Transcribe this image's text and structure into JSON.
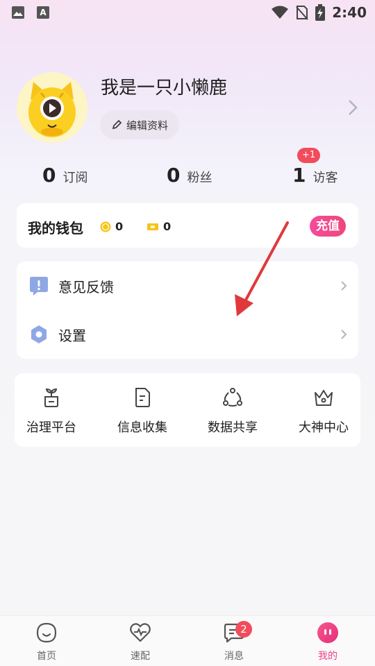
{
  "status_bar": {
    "time": "2:40",
    "icons": [
      "image-icon",
      "font-a-icon",
      "wifi-icon",
      "no-sim-icon",
      "battery-charging-icon"
    ]
  },
  "profile": {
    "username": "我是一只小懒鹿",
    "edit_label": "编辑资料"
  },
  "stats": [
    {
      "value": "0",
      "label": "订阅"
    },
    {
      "value": "0",
      "label": "粉丝"
    },
    {
      "value": "1",
      "label": "访客",
      "badge": "+1"
    }
  ],
  "wallet": {
    "title": "我的钱包",
    "coins": "0",
    "tickets": "0",
    "recharge_label": "充值"
  },
  "menu": [
    {
      "label": "意见反馈",
      "icon": "feedback-icon"
    },
    {
      "label": "设置",
      "icon": "settings-icon"
    }
  ],
  "tools": [
    {
      "label": "治理平台",
      "icon": "plant-icon"
    },
    {
      "label": "信息收集",
      "icon": "document-icon"
    },
    {
      "label": "数据共享",
      "icon": "share-nodes-icon"
    },
    {
      "label": "大神中心",
      "icon": "crown-icon"
    }
  ],
  "tabbar": [
    {
      "label": "首页",
      "icon": "home-face-icon"
    },
    {
      "label": "速配",
      "icon": "heart-pulse-icon"
    },
    {
      "label": "消息",
      "icon": "chat-icon",
      "badge": "2"
    },
    {
      "label": "我的",
      "icon": "me-face-icon",
      "active": true
    }
  ],
  "colors": {
    "accent": "#ec3f86",
    "badge_red": "#f24b5b",
    "annotation_arrow": "#e0393b"
  }
}
